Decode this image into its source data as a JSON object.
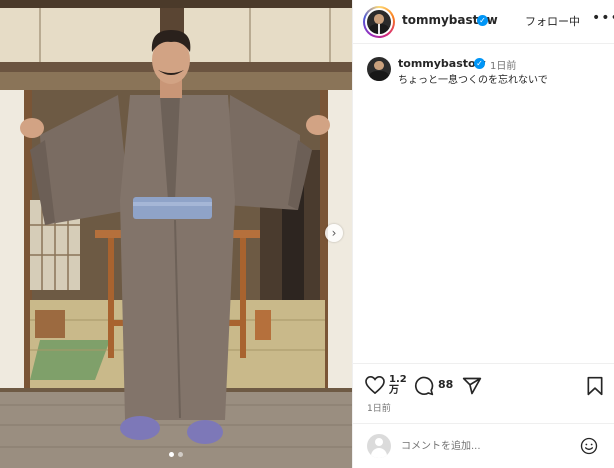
{
  "post": {
    "username": "tommybastow",
    "follow_label": "フォロー中",
    "caption_username": "tommybastow",
    "caption_time": "1日前",
    "caption_text": "ちょっと一息つくのを忘れないで",
    "likes_line1": "1.2",
    "likes_line2": "万",
    "comments": "88",
    "posted": "1日前",
    "comment_placeholder": "コメントを追加...",
    "verified_mark": "✓"
  },
  "carousel": {
    "total": 2,
    "active": 1
  },
  "icons": {
    "like": "heart-icon",
    "comment": "comment-bubble-icon",
    "share": "paper-plane-icon",
    "save": "bookmark-icon",
    "emoji": "emoji-smile-icon",
    "more": "more-dots-icon",
    "verified": "verified-badge-icon",
    "next": "chevron-right-icon"
  },
  "colors": {
    "accent": "#0095f6",
    "text": "#262626",
    "muted": "#737373",
    "divider": "#efefef"
  }
}
